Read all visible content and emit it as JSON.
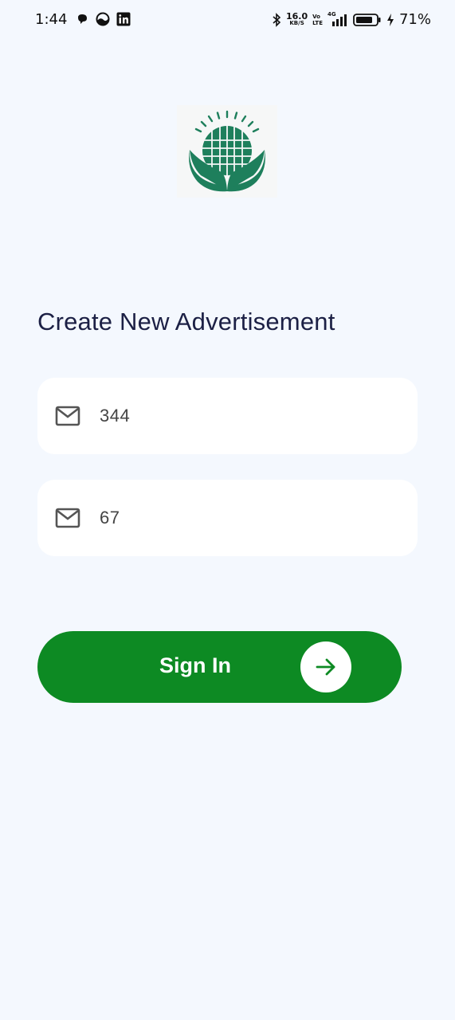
{
  "status_bar": {
    "time": "1:44",
    "net_speed_value": "16.0",
    "net_speed_unit": "KB/S",
    "volte_top": "Vo",
    "volte_bottom": "LTE",
    "network": "4G",
    "battery_percent": "71%",
    "left_icons": [
      "chat-bubble-icon",
      "circle-app-icon",
      "linkedin-icon"
    ],
    "right_icons": [
      "bluetooth-icon",
      "signal-icon",
      "battery-icon",
      "charging-icon"
    ]
  },
  "page": {
    "title": "Create New Advertisement",
    "logo": "globe-leaves-logo"
  },
  "form": {
    "field_1": {
      "value": "344",
      "icon": "mail-icon"
    },
    "field_2": {
      "value": "67",
      "icon": "mail-icon"
    },
    "submit_label": "Sign In",
    "submit_icon": "arrow-right-icon"
  },
  "colors": {
    "background": "#f4f8fe",
    "field_background": "#ffffff",
    "accent_green": "#0d8a23",
    "logo_green": "#1e7f5c",
    "title_text": "#1c2045"
  }
}
